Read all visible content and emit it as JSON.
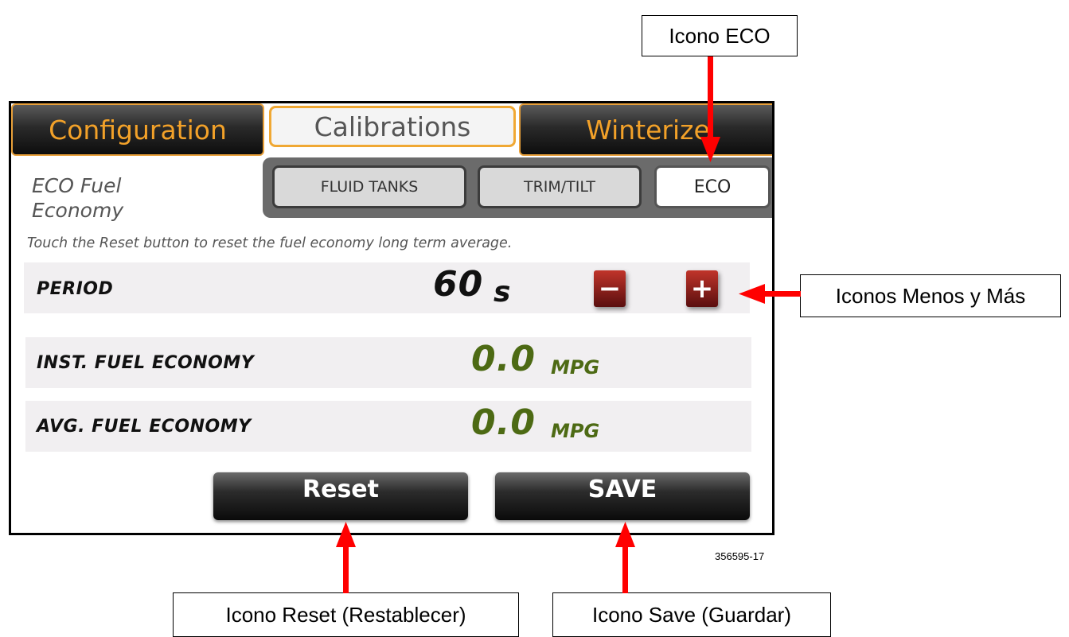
{
  "tabs": [
    {
      "label": "Configuration",
      "state": "inactive"
    },
    {
      "label": "Calibrations",
      "state": "active"
    },
    {
      "label": "Winterize",
      "state": "inactive"
    }
  ],
  "section_title": "ECO Fuel Economy",
  "subtabs": [
    {
      "label": "FLUID TANKS",
      "state": "inactive"
    },
    {
      "label": "TRIM/TILT",
      "state": "inactive"
    },
    {
      "label": "ECO",
      "state": "active"
    }
  ],
  "hint_text": "Touch the Reset button to reset the fuel economy long term average.",
  "period": {
    "label": "PERIOD",
    "value": "60",
    "unit": "s",
    "minus_icon": "minus-icon",
    "plus_icon": "plus-icon"
  },
  "inst_fuel": {
    "label": "INST. FUEL ECONOMY",
    "value": "0.0",
    "unit": "MPG"
  },
  "avg_fuel": {
    "label": "AVG. FUEL ECONOMY",
    "value": "0.0",
    "unit": "MPG"
  },
  "buttons": {
    "reset_label": "Reset",
    "save_label": "SAVE"
  },
  "callouts": {
    "eco": "Icono ECO",
    "minus_plus": "Iconos Menos y Más",
    "reset": "Icono Reset (Restablecer)",
    "save": "Icono Save (Guardar)"
  },
  "figure_id": "356595-17",
  "colors": {
    "tab_text": "#f2a129",
    "tab_border": "#e8a03a",
    "value_green": "#4d6a14",
    "arrow_red": "#ff0000",
    "stepper_red": "#8b1a14"
  }
}
